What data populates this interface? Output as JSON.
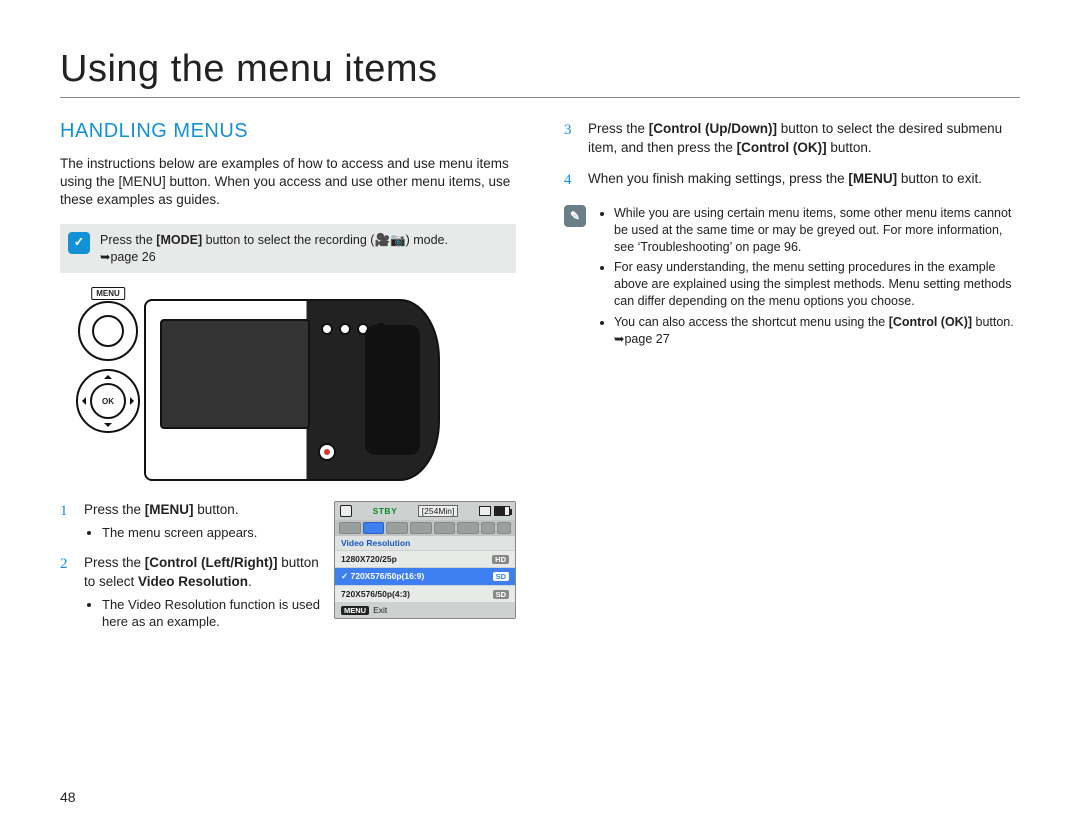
{
  "chapter_title": "Using the menu items",
  "section_heading": "HANDLING MENUS",
  "intro_text": "The instructions below are examples of how to access and use menu items using the [MENU] button. When you access and use other menu items, use these examples as guides.",
  "mode_note": {
    "prefix": "Press the ",
    "bold1": "[MODE]",
    "mid": " button to select the recording (",
    "icons_hint": "video/photo",
    "suffix": ") mode.",
    "page_ref": "page 26"
  },
  "camera": {
    "menu_label": "MENU",
    "ok_label": "OK"
  },
  "steps_left": [
    {
      "num": "1",
      "text_parts": [
        "Press the ",
        "[MENU]",
        " button."
      ],
      "sub": [
        "The menu screen appears."
      ]
    },
    {
      "num": "2",
      "text_parts": [
        "Press the ",
        "[Control (Left/Right)]",
        " button to select ",
        "Video Resolution",
        "."
      ],
      "sub": [
        "The Video Resolution function is used here as an example."
      ]
    }
  ],
  "steps_right": [
    {
      "num": "3",
      "text_parts": [
        "Press the ",
        "[Control (Up/Down)]",
        " button to select the desired submenu item, and then press the ",
        "[Control (OK)]",
        " button."
      ]
    },
    {
      "num": "4",
      "text_parts": [
        "When you finish making settings, press the ",
        "[MENU]",
        " button to exit."
      ]
    }
  ],
  "tips": [
    "While you are using certain menu items, some other menu items cannot be used at the same time or may be greyed out. For more information, see ‘Troubleshooting’ on page 96.",
    "For easy understanding, the menu setting procedures in the example above are explained using the simplest methods. Menu setting methods can differ depending on the menu options you choose."
  ],
  "tip_last": {
    "pre": "You can also access the shortcut menu using the ",
    "bold": "[Control (OK)]",
    "post": " button. ",
    "page_ref": "page 27"
  },
  "lcd": {
    "stby": "STBY",
    "time": "[254Min]",
    "header": "Video Resolution",
    "rows": [
      {
        "label": "1280X720/25p",
        "badge": "HD",
        "selected": false
      },
      {
        "label": "720X576/50p(16:9)",
        "badge": "SD",
        "selected": true
      },
      {
        "label": "720X576/50p(4:3)",
        "badge": "SD",
        "selected": false
      }
    ],
    "exit_btn": "MENU",
    "exit_label": "Exit"
  },
  "page_number": "48",
  "note_icon_glyph": "✓",
  "tip_icon_glyph": "✎",
  "arrow_glyph": "➥"
}
